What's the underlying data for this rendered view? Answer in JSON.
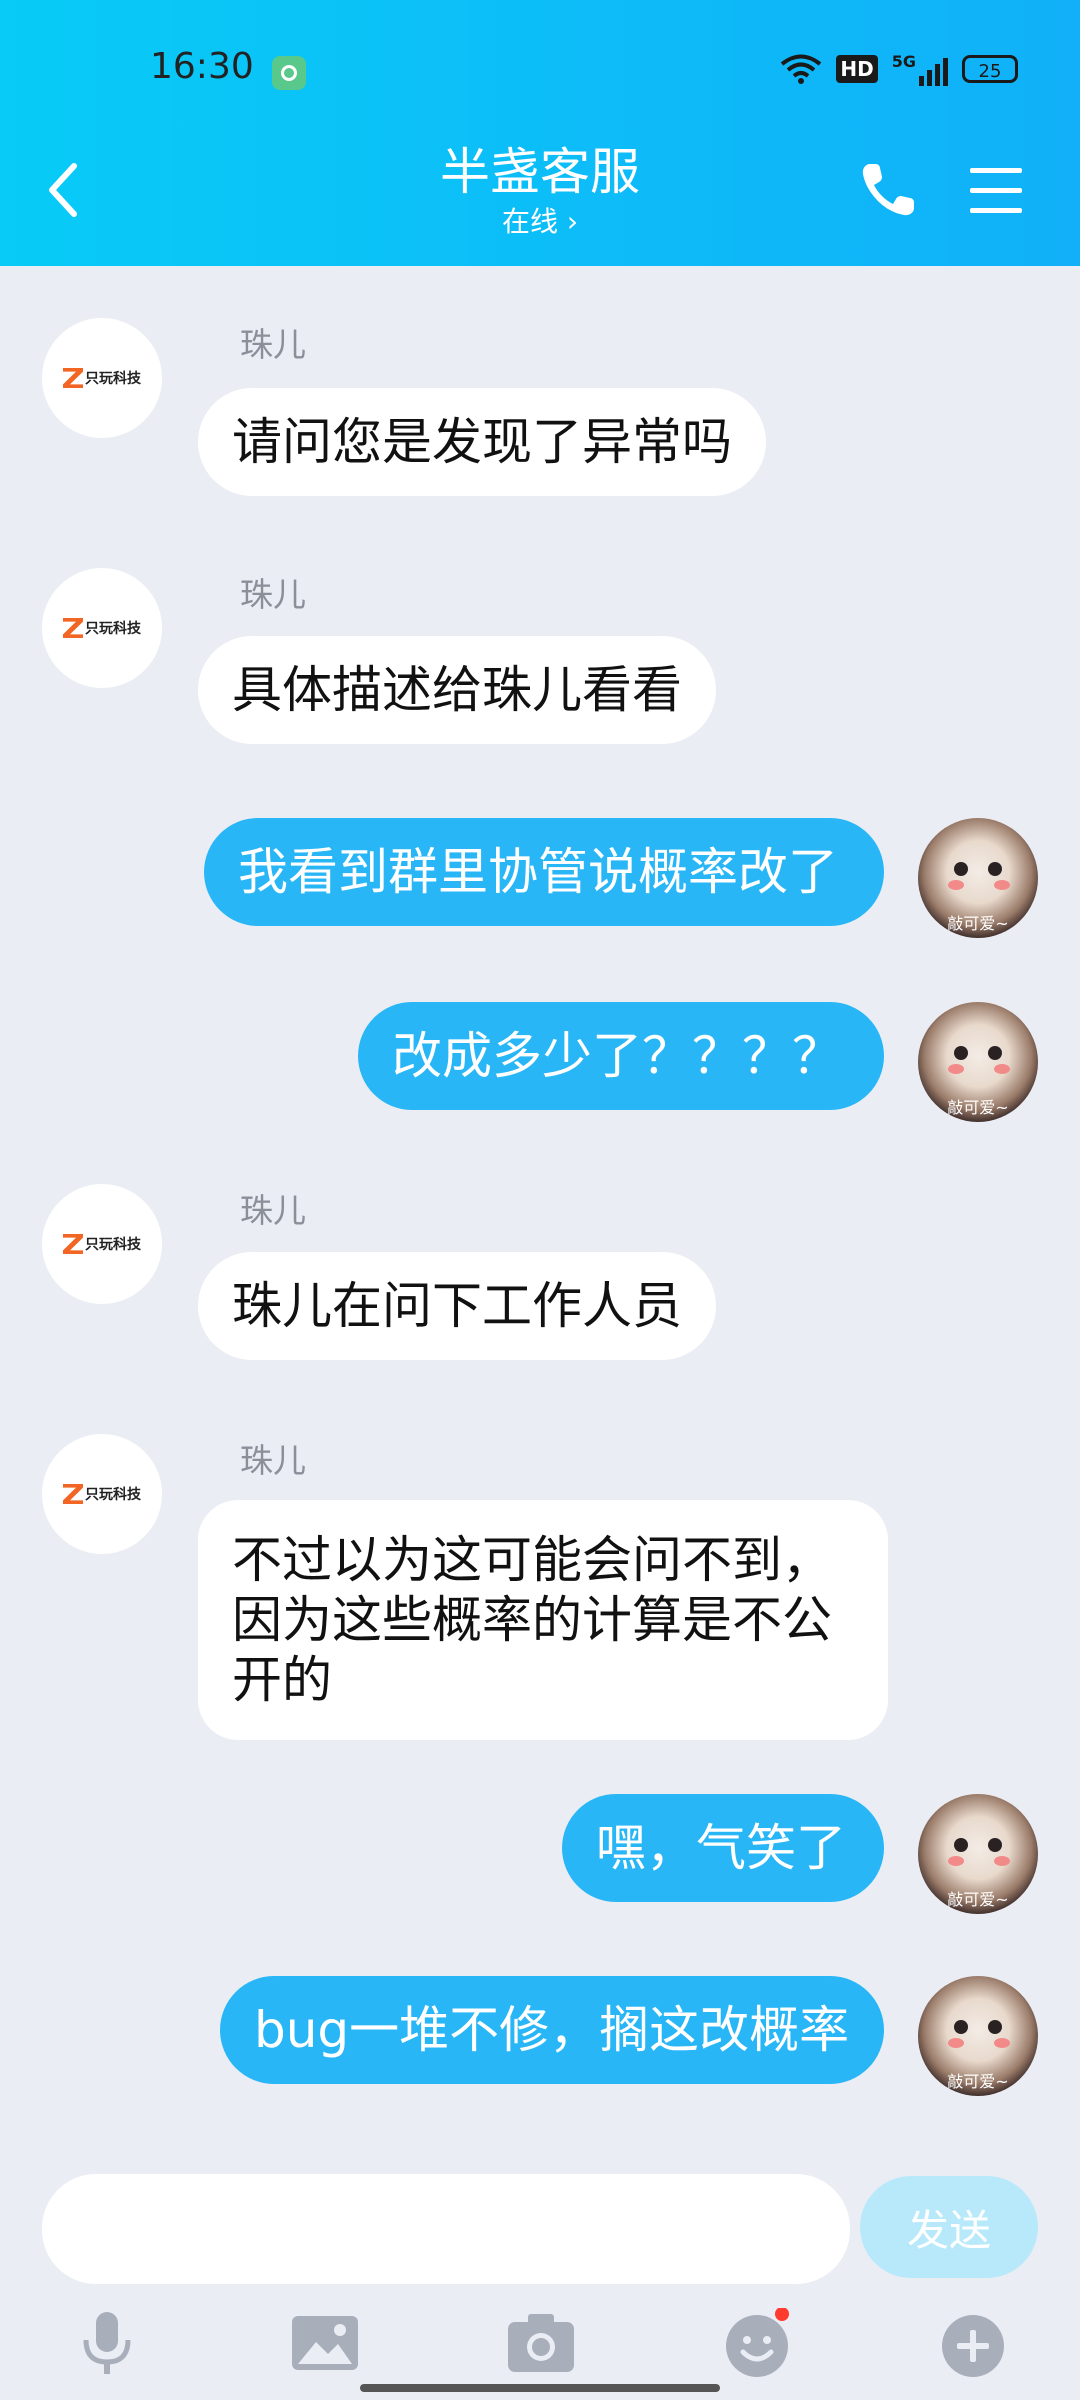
{
  "status_bar": {
    "time": "16:30",
    "network": "5G",
    "hd": "HD",
    "battery": "25"
  },
  "header": {
    "title": "半盏客服",
    "subtitle": "在线 ›"
  },
  "messages": [
    {
      "side": "in",
      "sender": "珠儿",
      "text": "请问您是发现了异常吗"
    },
    {
      "side": "in",
      "sender": "珠儿",
      "text": "具体描述给珠儿看看"
    },
    {
      "side": "out",
      "text": "我看到群里协管说概率改了"
    },
    {
      "side": "out",
      "text": "改成多少了？？？？"
    },
    {
      "side": "in",
      "sender": "珠儿",
      "text": "珠儿在问下工作人员"
    },
    {
      "side": "in",
      "sender": "珠儿",
      "text": "不过以为这可能会问不到，因为这些概率的计算是不公开的"
    },
    {
      "side": "out",
      "text": "嘿，气笑了"
    },
    {
      "side": "out",
      "text": "bug一堆不修，搁这改概率"
    }
  ],
  "avatar": {
    "brand_logo_text": "只玩科技",
    "user_caption": "敲可爱~"
  },
  "composer": {
    "input_value": "",
    "send_label": "发送"
  },
  "colors": {
    "header_gradient_start": "#08cbf7",
    "header_gradient_end": "#11b0f8",
    "outgoing_bubble": "#29b6f6",
    "incoming_bubble": "#ffffff",
    "background": "#eaedf4",
    "send_button_disabled": "#b8e9fb",
    "notification_dot": "#ff3b30"
  },
  "toolbar_icons": [
    "microphone-icon",
    "image-icon",
    "camera-icon",
    "emoji-icon",
    "plus-icon"
  ]
}
